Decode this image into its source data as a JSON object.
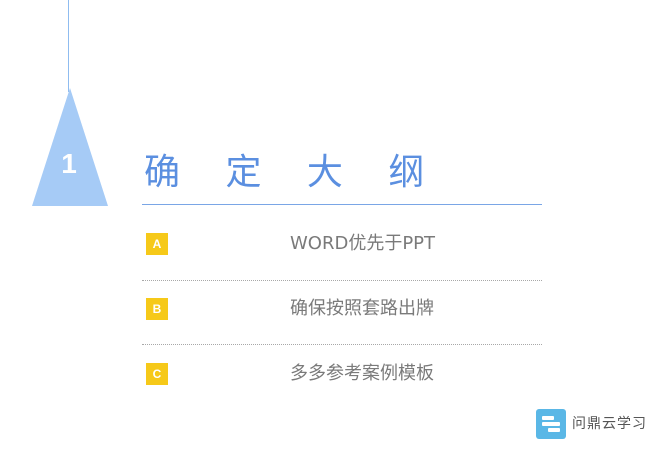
{
  "section": {
    "number": "1",
    "title": "确 定 大 纲"
  },
  "items": [
    {
      "badge": "A",
      "text": "WORD优先于PPT"
    },
    {
      "badge": "B",
      "text": "确保按照套路出牌"
    },
    {
      "badge": "C",
      "text": "多多参考案例模板"
    }
  ],
  "brand": {
    "icon": "stacked-bars-logo-icon",
    "name": "问鼎云学习"
  },
  "colors": {
    "accent_blue": "#5b8fe0",
    "triangle_blue": "#a6cbf6",
    "badge_yellow": "#f6c919",
    "text_gray": "#7a7a7a"
  }
}
